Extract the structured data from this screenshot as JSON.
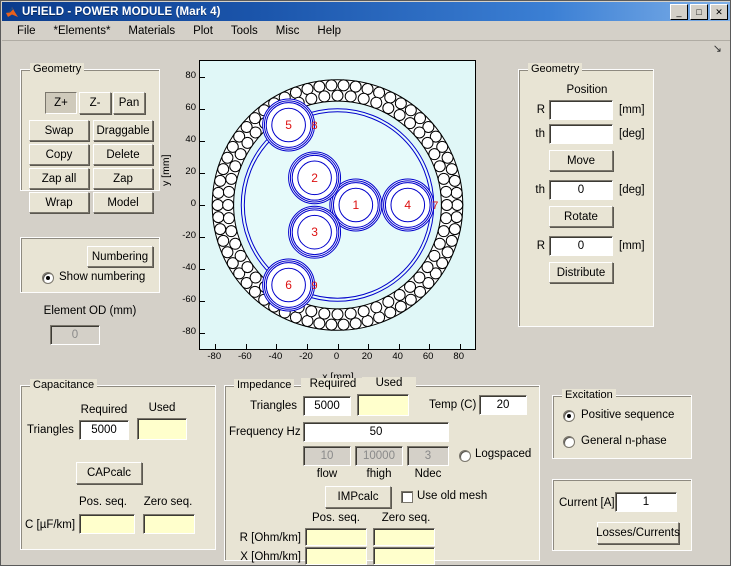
{
  "window": {
    "title": "UFIELD - POWER MODULE (Mark 4)",
    "logo_icon": "matlab-logo-icon",
    "minimize_label": "_",
    "maximize_label": "□",
    "close_label": "✕",
    "resize_glyph": "↘"
  },
  "menu": {
    "items": [
      {
        "label": "File"
      },
      {
        "label": "*Elements*"
      },
      {
        "label": "Materials"
      },
      {
        "label": "Plot"
      },
      {
        "label": "Tools"
      },
      {
        "label": "Misc"
      },
      {
        "label": "Help"
      }
    ]
  },
  "geometry_left": {
    "title": "Geometry",
    "zoom_in": "Z+",
    "zoom_out": "Z-",
    "pan": "Pan",
    "swap": "Swap",
    "draggable": "Draggable",
    "copy": "Copy",
    "delete": "Delete",
    "zap_all": "Zap all",
    "zap": "Zap",
    "wrap": "Wrap",
    "model": "Model"
  },
  "numbering_panel": {
    "numbering_button": "Numbering",
    "show_numbering_label": "Show numbering",
    "show_numbering_checked": true
  },
  "element_od": {
    "label": "Element OD (mm)",
    "value": "0"
  },
  "geometry_right": {
    "title": "Geometry",
    "position_label": "Position",
    "r_label": "R",
    "r_value": "",
    "r_unit": "[mm]",
    "th_label": "th",
    "th_value": "",
    "th_unit": "[deg]",
    "move_button": "Move",
    "rotate_th_label": "th",
    "rotate_th_value": "0",
    "rotate_th_unit": "[deg]",
    "rotate_button": "Rotate",
    "distribute_r_label": "R",
    "distribute_r_value": "0",
    "distribute_r_unit": "[mm]",
    "distribute_button": "Distribute"
  },
  "capacitance": {
    "title": "Capacitance",
    "required_label": "Required",
    "used_label": "Used",
    "triangles_label": "Triangles",
    "triangles_required": "5000",
    "triangles_used": "",
    "calc_button": "CAPcalc",
    "pos_seq_label": "Pos. seq.",
    "zero_seq_label": "Zero seq.",
    "c_label": "C [µF/km]",
    "c_pos_seq": "",
    "c_zero_seq": ""
  },
  "impedance": {
    "title": "Impedance",
    "required_label": "Required",
    "used_label": "Used",
    "triangles_label": "Triangles",
    "triangles_required": "5000",
    "triangles_used": "",
    "temp_label": "Temp (C)",
    "temp_value": "20",
    "frequency_label": "Frequency Hz",
    "frequency_value": "50",
    "flow_value": "10",
    "flow_label": "flow",
    "fhigh_value": "10000",
    "fhigh_label": "fhigh",
    "ndec_value": "3",
    "ndec_label": "Ndec",
    "logspaced_label": "Logspaced",
    "logspaced_checked": false,
    "calc_button": "IMPcalc",
    "use_old_mesh_label": "Use old mesh",
    "use_old_mesh_checked": false,
    "pos_seq_label": "Pos. seq.",
    "zero_seq_label": "Zero seq.",
    "r_label": "R [Ohm/km]",
    "r_pos_seq": "",
    "r_zero_seq": "",
    "x_label": "X [Ohm/km]",
    "x_pos_seq": "",
    "x_zero_seq": ""
  },
  "excitation": {
    "title": "Excitation",
    "positive_sequence_label": "Positive sequence",
    "positive_sequence_selected": true,
    "general_n_phase_label": "General n-phase",
    "general_n_phase_selected": false
  },
  "current": {
    "label": "Current [A]",
    "value": "1",
    "button": "Losses/Currents"
  },
  "chart_data": {
    "type": "scatter",
    "title": "",
    "xlabel": "x [mm]",
    "ylabel": "y [mm]",
    "xlim": [
      -90,
      90
    ],
    "ylim": [
      -90,
      90
    ],
    "xticks": [
      -80,
      -60,
      -40,
      -20,
      0,
      20,
      40,
      60,
      80
    ],
    "yticks": [
      -80,
      -60,
      -40,
      -20,
      0,
      20,
      40,
      60,
      80
    ],
    "grid": false,
    "plot_background": "#e0f7f7",
    "conductor_color": "#0000cc",
    "label_color": "#dd1111",
    "armour_color": "#000000",
    "cable": {
      "armour_outer_radius_mm": 82,
      "armour_inner_radius_mm": 68,
      "sheath_radius_mm": 63,
      "inner_boundary_radius_mm": 61,
      "armour_wire_radius_mm": 3.6,
      "armour_wire_count_outer": 62,
      "armour_wire_count_inner": 52
    },
    "conductors": [
      {
        "id": "1",
        "x_mm": 12,
        "y_mm": 0,
        "outer_r_mm": 17,
        "core_r_mm": 11
      },
      {
        "id": "2",
        "x_mm": -15,
        "y_mm": 17,
        "outer_r_mm": 17,
        "core_r_mm": 11
      },
      {
        "id": "3",
        "x_mm": -15,
        "y_mm": -17,
        "outer_r_mm": 17,
        "core_r_mm": 11
      },
      {
        "id": "4",
        "x_mm": 46,
        "y_mm": 0,
        "outer_r_mm": 17,
        "core_r_mm": 11
      },
      {
        "id": "5",
        "x_mm": -32,
        "y_mm": 50,
        "outer_r_mm": 17,
        "core_r_mm": 11
      },
      {
        "id": "6",
        "x_mm": -32,
        "y_mm": -50,
        "outer_r_mm": 17,
        "core_r_mm": 11
      }
    ],
    "markers": [
      {
        "label": "8",
        "x_mm": -15,
        "y_mm": 50
      },
      {
        "label": "7",
        "x_mm": 64,
        "y_mm": 0
      },
      {
        "label": "9",
        "x_mm": -15,
        "y_mm": -50
      }
    ]
  }
}
